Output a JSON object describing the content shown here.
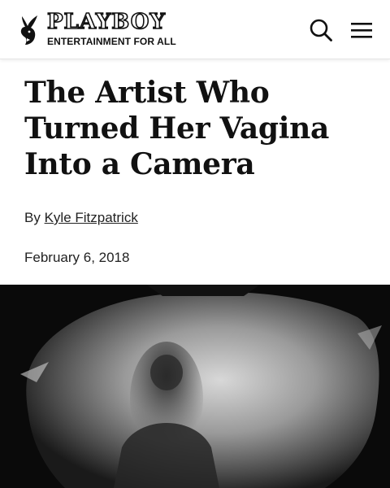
{
  "header": {
    "brand_name": "PLAYBOY",
    "tagline": "ENTERTAINMENT FOR ALL",
    "logo_icon": "playboy-bunny-icon",
    "search_icon": "search-icon",
    "menu_icon": "hamburger-menu-icon"
  },
  "article": {
    "headline": "The Artist Who Turned Her Vagina Into a Camera",
    "byline_prefix": "By",
    "author": "Kyle Fitzpatrick",
    "date": "February 6, 2018",
    "hero_image": "black-and-white pinhole photograph"
  },
  "colors": {
    "text": "#111111",
    "background": "#ffffff",
    "header_border": "#e4e4e4",
    "hero_dark": "#0a0a0a"
  }
}
